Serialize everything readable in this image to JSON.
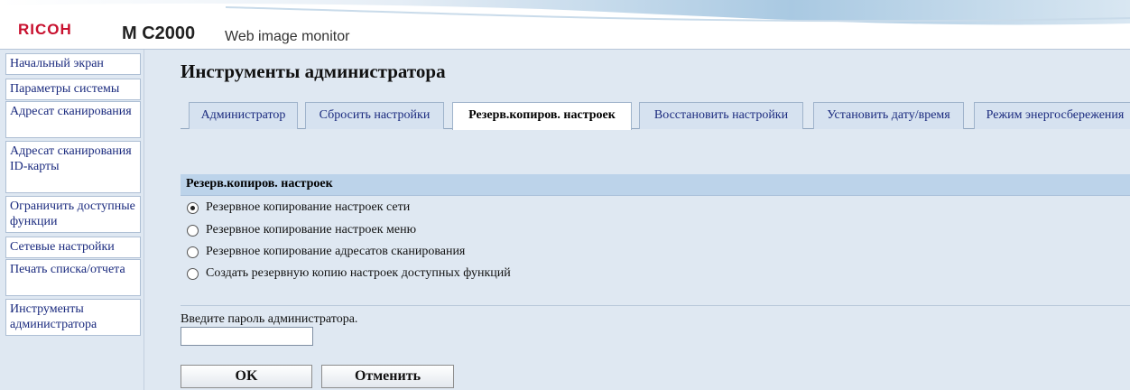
{
  "header": {
    "brand": "RICOH",
    "model": "M C2000",
    "app_name": "Web image monitor"
  },
  "sidebar": {
    "items": [
      {
        "label": "Начальный экран"
      },
      {
        "label": "Параметры системы"
      },
      {
        "label": "Адресат сканирования"
      },
      {
        "label": "Адресат сканирования ID-карты"
      },
      {
        "label": "Ограничить доступные функции"
      },
      {
        "label": "Сетевые настройки"
      },
      {
        "label": "Печать списка/отчета"
      },
      {
        "label": "Инструменты администратора"
      }
    ]
  },
  "main": {
    "title": "Инструменты администратора",
    "tabs": [
      {
        "label": "Администратор"
      },
      {
        "label": "Сбросить настройки"
      },
      {
        "label": "Резерв.копиров. настроек",
        "active": true
      },
      {
        "label": "Восстановить настройки"
      },
      {
        "label": "Установить дату/время"
      },
      {
        "label": "Режим энергосбережения"
      }
    ],
    "section_title": "Резерв.копиров. настроек",
    "options": [
      {
        "label": "Резервное копирование настроек сети",
        "checked": true
      },
      {
        "label": "Резервное копирование настроек меню",
        "checked": false
      },
      {
        "label": "Резервное копирование адресатов сканирования",
        "checked": false
      },
      {
        "label": "Создать резервную копию настроек доступных функций",
        "checked": false
      }
    ],
    "password_label": "Введите пароль администратора.",
    "password_value": "",
    "ok_label": "OK",
    "cancel_label": "Отменить"
  },
  "colors": {
    "brand_red": "#c8102e",
    "page_bg": "#dfe8f2",
    "section_bg": "#bcd3ea",
    "link_blue": "#1a2a7e"
  }
}
